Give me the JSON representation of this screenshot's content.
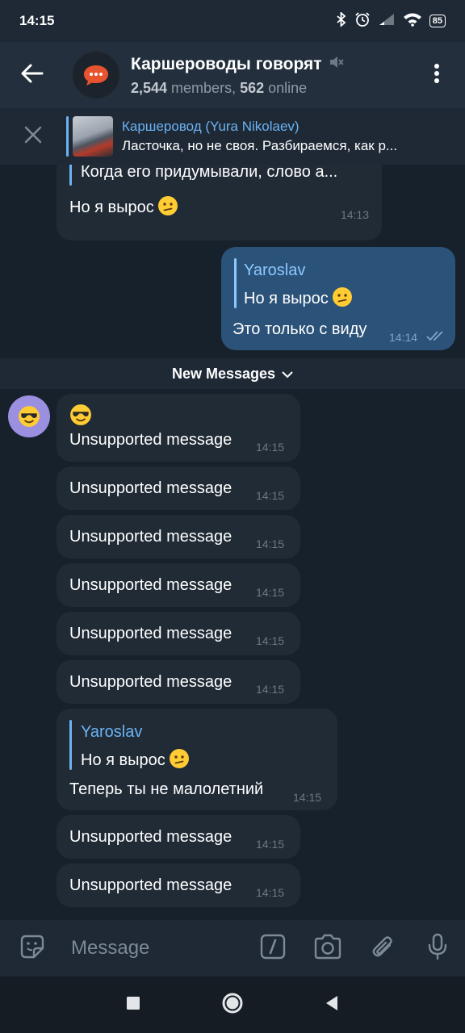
{
  "status_bar": {
    "time": "14:15",
    "battery": "85"
  },
  "header": {
    "title": "Каршероводы говорят",
    "members_count": "2,544",
    "members_label": " members, ",
    "online_count": "562",
    "online_label": " online"
  },
  "pinned": {
    "title": "Каршеровод (Yura Nikolaev)",
    "text": "Ласточка, но не своя. Разбираемся, как р..."
  },
  "messages": {
    "m1": {
      "quote_text": "Когда его придумывали, слово а...",
      "text": "Но я вырос",
      "time": "14:13"
    },
    "m2": {
      "quote_name": "Yaroslav",
      "quote_text": "Но я вырос",
      "text": "Это только с виду",
      "time": "14:14"
    },
    "new_messages_label": "New Messages",
    "m3": {
      "text": "Unsupported message",
      "time": "14:15"
    },
    "unsupported": [
      {
        "text": "Unsupported message",
        "time": "14:15"
      },
      {
        "text": "Unsupported message",
        "time": "14:15"
      },
      {
        "text": "Unsupported message",
        "time": "14:15"
      },
      {
        "text": "Unsupported message",
        "time": "14:15"
      },
      {
        "text": "Unsupported message",
        "time": "14:15"
      }
    ],
    "m4": {
      "quote_name": "Yaroslav",
      "quote_text": "Но я вырос",
      "text": "Теперь ты не малолетний",
      "time": "14:15"
    },
    "unsupported2": [
      {
        "text": "Unsupported message",
        "time": "14:15"
      },
      {
        "text": "Unsupported message",
        "time": "14:15"
      }
    ]
  },
  "input": {
    "placeholder": "Message"
  },
  "icons": {
    "back": "arrow-left-icon",
    "mute": "mute-icon",
    "menu": "more-vert-icon",
    "close": "close-icon",
    "emoji": "emoji-sticker-icon",
    "commands": "slash-command-icon",
    "camera": "camera-icon",
    "attach": "paperclip-icon",
    "mic": "microphone-icon"
  },
  "colors": {
    "accent": "#6ab3f3",
    "background": "#17212b",
    "incoming": "#202b36",
    "outgoing": "#2b5278"
  }
}
